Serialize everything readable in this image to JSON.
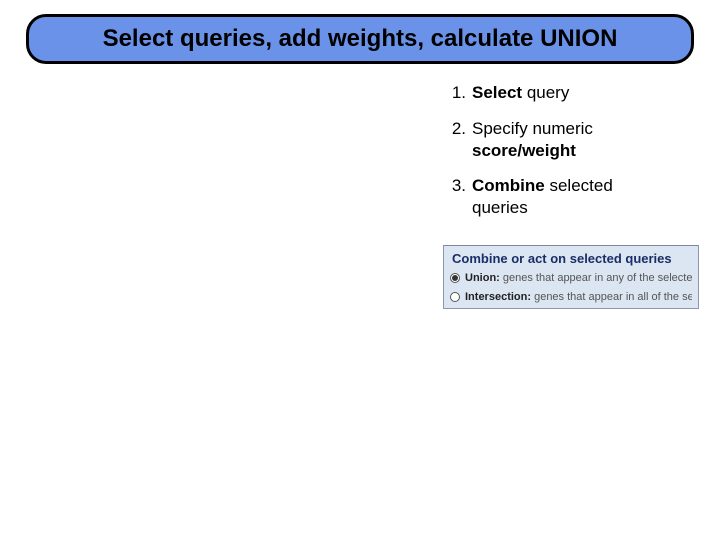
{
  "title": "Select queries, add weights, calculate UNION",
  "steps": [
    {
      "num": "1.",
      "bold": "Select",
      "rest": " query"
    },
    {
      "num": "2.",
      "text_a": "Specify numeric",
      "bold_b": "score/weight"
    },
    {
      "num": "3.",
      "bold": "Combine",
      "rest": " selected",
      "rest2": "queries"
    }
  ],
  "panel": {
    "title": "Combine or act on selected queries",
    "options": [
      {
        "checked": true,
        "name": "Union:",
        "desc": "genes that appear in any of the selected queries"
      },
      {
        "checked": false,
        "name": "Intersection:",
        "desc": "genes that appear in all of the selected lists."
      }
    ]
  }
}
